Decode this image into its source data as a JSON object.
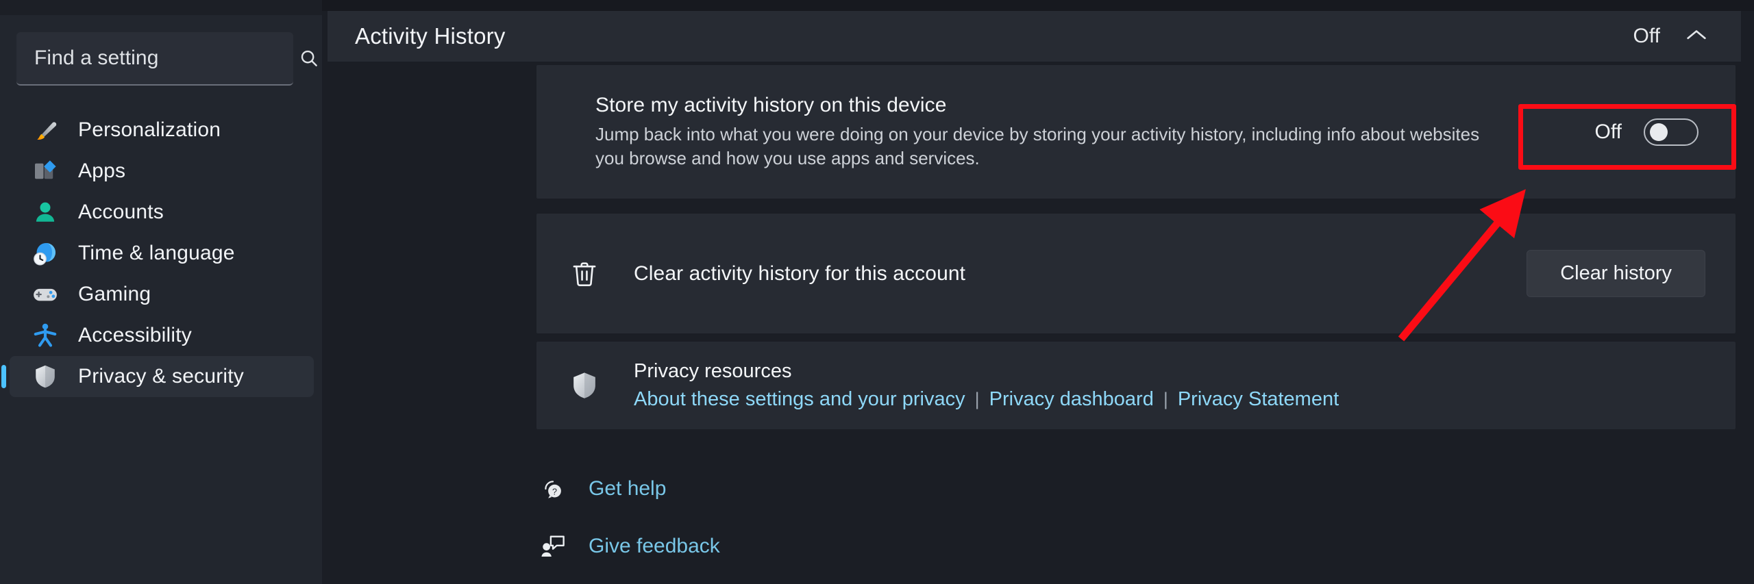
{
  "search": {
    "placeholder": "Find a setting",
    "value": "",
    "icon": "search-icon"
  },
  "sidebar": {
    "items": [
      {
        "label": "Personalization",
        "icon": "paintbrush-icon",
        "selected": false
      },
      {
        "label": "Apps",
        "icon": "apps-icon",
        "selected": false
      },
      {
        "label": "Accounts",
        "icon": "person-icon",
        "selected": false
      },
      {
        "label": "Time & language",
        "icon": "clock-globe-icon",
        "selected": false
      },
      {
        "label": "Gaming",
        "icon": "gamepad-icon",
        "selected": false
      },
      {
        "label": "Accessibility",
        "icon": "accessibility-person-icon",
        "selected": false
      },
      {
        "label": "Privacy & security",
        "icon": "shield-icon",
        "selected": true
      }
    ]
  },
  "main": {
    "section_header": {
      "title": "Activity History",
      "state": "Off",
      "chevron": "chevron-up-icon"
    },
    "store_activity": {
      "title": "Store my activity history on this device",
      "description": "Jump back into what you were doing on your device by storing your activity history, including info about websites you browse and how you use apps and services.",
      "toggle_state": "Off",
      "toggle_on": false
    },
    "clear_activity": {
      "icon": "trash-icon",
      "label": "Clear activity history for this account",
      "button_label": "Clear history"
    },
    "privacy_resources": {
      "icon": "shield-icon",
      "title": "Privacy resources",
      "links": [
        "About these settings and your privacy",
        "Privacy dashboard",
        "Privacy Statement"
      ],
      "separator": "|"
    },
    "footer": [
      {
        "label": "Get help",
        "icon": "help-question-icon"
      },
      {
        "label": "Give feedback",
        "icon": "feedback-icon"
      }
    ]
  },
  "annotations": {
    "highlight_color": "#fb0c15",
    "highlight_target": "activity-history-toggle",
    "arrow_color": "#fb0c15"
  },
  "colors": {
    "accent": "#4cc2ff",
    "link": "#8ed8f8",
    "panel_bg": "#272b33",
    "window_bg": "#1b1e25",
    "sidebar_bg": "#22262e"
  }
}
